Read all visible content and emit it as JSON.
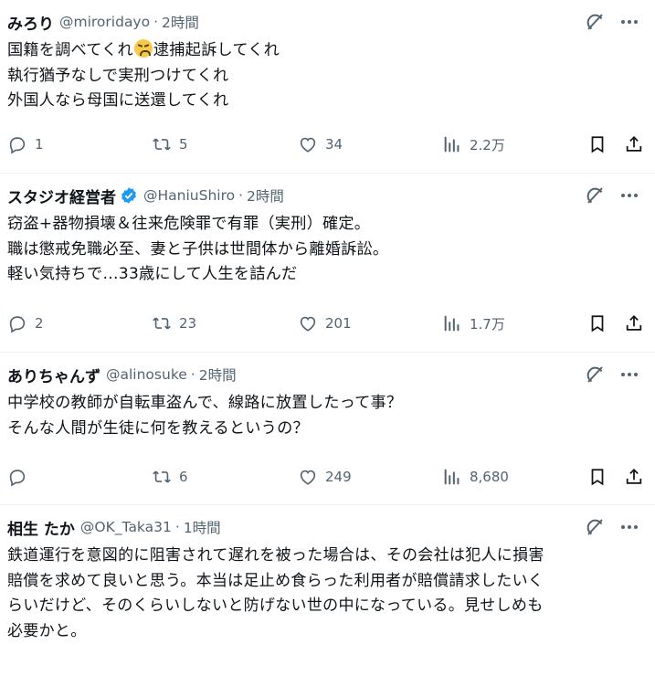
{
  "tweets": [
    {
      "name": "みろり",
      "handle": "@miroridayo",
      "time": "2時間",
      "verified": false,
      "line1_a": "国籍を調べてくれ",
      "line1_emoji": "tired-face-emoji",
      "line1_b": "逮捕起訴してくれ",
      "body_rest": "執行猶予なしで実刑つけてくれ\n外国人なら母国に送還してくれ",
      "replies": "1",
      "reposts": "5",
      "likes": "34",
      "views": "2.2万"
    },
    {
      "name": "スタジオ経営者",
      "handle": "@HaniuShiro",
      "time": "2時間",
      "verified": true,
      "body": "窃盗+器物損壊＆往来危険罪で有罪（実刑）確定。\n職は懲戒免職必至、妻と子供は世間体から離婚訴訟。\n軽い気持ちで…33歳にして人生を詰んだ",
      "replies": "2",
      "reposts": "23",
      "likes": "201",
      "views": "1.7万"
    },
    {
      "name": "ありちゃんず",
      "handle": "@alinosuke",
      "time": "2時間",
      "verified": false,
      "body": "中学校の教師が自転車盗んで、線路に放置したって事？\nそんな人間が生徒に何を教えるというの？",
      "replies": "",
      "reposts": "6",
      "likes": "249",
      "views": "8,680"
    },
    {
      "name": "相生 たか",
      "handle": "@OK_Taka31",
      "time": "1時間",
      "verified": false,
      "body": "鉄道運行を意図的に阻害されて遅れを被った場合は、その会社は犯人に損害\n賠償を求めて良いと思う。本当は足止め食らった利用者が賠償請求したいく\nらいだけど、そのくらいしないと防げない世の中になっている。見せしめも\n必要かと。"
    }
  ],
  "separator": "·",
  "colors": {
    "text": "#0f1419",
    "secondary": "#536471",
    "verified": "#1d9bf0",
    "divider": "#eff3f4"
  }
}
